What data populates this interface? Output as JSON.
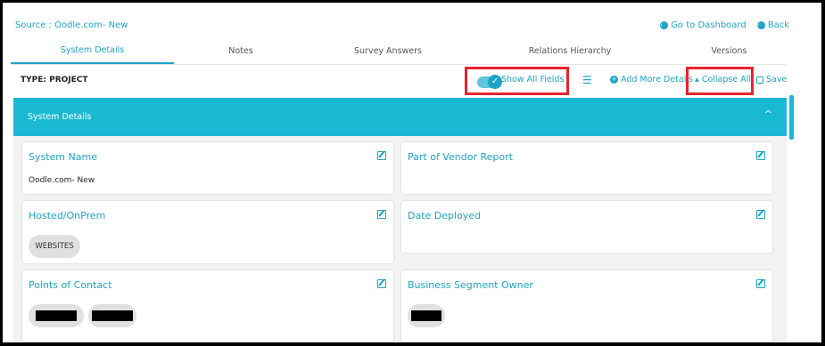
{
  "header": {
    "source": "Source : Oodle.com- New",
    "go_to_dashboard": "Go to Dashboard",
    "back": "Back"
  },
  "tabs": [
    {
      "label": "System Details",
      "active": true
    },
    {
      "label": "Notes",
      "active": false
    },
    {
      "label": "Survey Answers",
      "active": false
    },
    {
      "label": "Relations Hierarchy",
      "active": false
    },
    {
      "label": "Versions",
      "active": false
    }
  ],
  "toolbar": {
    "type": "TYPE: PROJECT",
    "show_all_fields": "Show All Fields",
    "show_all_fields_on": true,
    "add_more_details": "Add More Details",
    "collapse_all": "Collapse All",
    "save": "Save"
  },
  "section": {
    "title": "System Details"
  },
  "fields": {
    "system_name": {
      "label": "System Name",
      "value": "Oodle.com- New"
    },
    "part_of_vendor_report": {
      "label": "Part of Vendor Report",
      "value": ""
    },
    "hosted_onprem": {
      "label": "Hosted/OnPrem",
      "chip": "WEBSITES"
    },
    "date_deployed": {
      "label": "Date Deployed",
      "value": ""
    },
    "points_of_contact": {
      "label": "Points of Contact"
    },
    "business_segment_owner": {
      "label": "Business Segment Owner"
    }
  },
  "colors": {
    "accent": "#1ea4c6",
    "banner": "#1ab9d3",
    "highlight": "#e8232f"
  }
}
